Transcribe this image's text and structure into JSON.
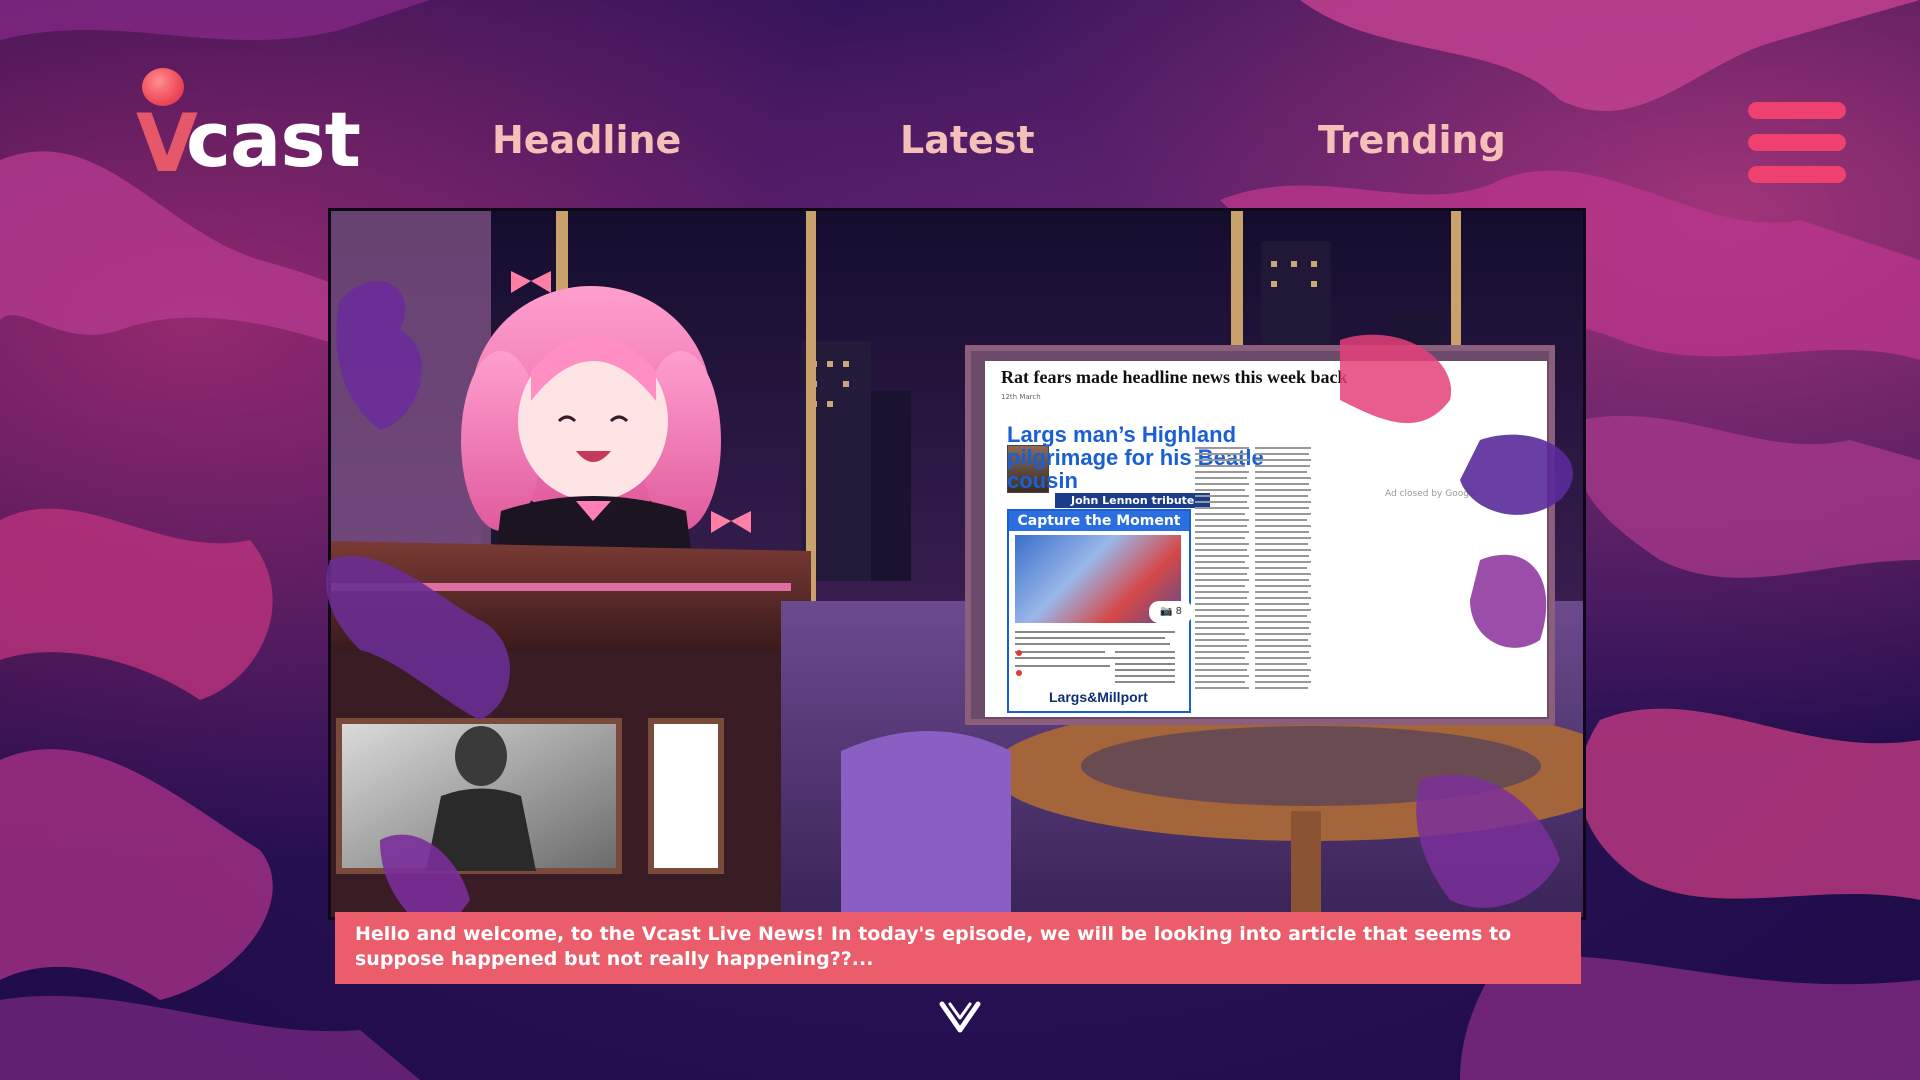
{
  "app": {
    "logo_text": "cast",
    "logo_letter": "V"
  },
  "nav": {
    "items": [
      {
        "label": "Headline"
      },
      {
        "label": "Latest"
      },
      {
        "label": "Trending"
      }
    ]
  },
  "video": {
    "newspaper": {
      "top_headline": "Rat fears made headline news this week back",
      "date": "12th March",
      "article_title": "Largs man’s Highland pilgrimage for his Beatle cousin",
      "tribute_label": "John Lennon tribute",
      "capture_title": "Capture the Moment",
      "camera_count": "8",
      "brand": "Largs&Millport",
      "ad_text": "Ad closed by Google"
    }
  },
  "caption": {
    "text": "Hello and welcome, to the Vcast Live News! In today's episode, we will be looking into article that seems to suppose happened but not really happening??..."
  },
  "colors": {
    "accent": "#ec5d6b",
    "menu": "#ef4170",
    "nav_text": "#f5c0b7",
    "background": "#2a1258"
  }
}
